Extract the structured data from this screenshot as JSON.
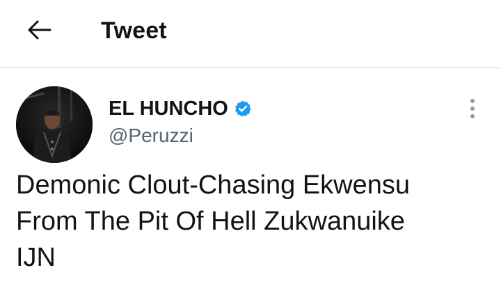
{
  "header": {
    "back_icon": "arrow-left-icon",
    "title": "Tweet"
  },
  "author": {
    "avatar_icon": "profile-photo",
    "display_name": "EL HUNCHO",
    "verified_icon": "verified-badge-icon",
    "verified_color": "#1d9bf0",
    "handle": "@Peruzzi"
  },
  "more_icon": "more-vertical-icon",
  "tweet": {
    "lines": [
      "Demonic Clout-Chasing Ekwensu",
      "From The Pit Of Hell Zukwanuike",
      "IJN"
    ]
  },
  "colors": {
    "text": "#0f1419",
    "secondary": "#536471",
    "divider": "#cfd9de"
  }
}
